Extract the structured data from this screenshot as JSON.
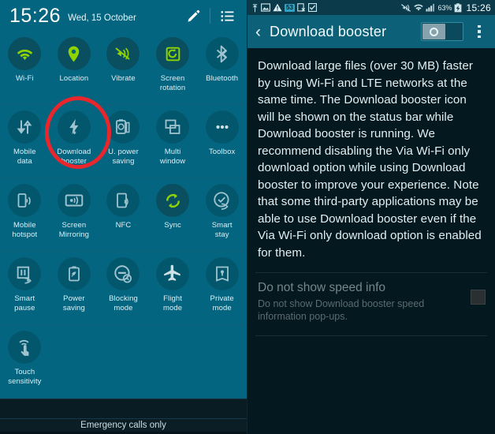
{
  "left_screen": {
    "header": {
      "clock": "15:26",
      "date": "Wed, 15 October",
      "edit_icon": "pencil-icon",
      "list_icon": "list-icon"
    },
    "quick_settings": [
      [
        {
          "label": "Wi-Fi",
          "icon": "wifi-icon",
          "state": "on"
        },
        {
          "label": "Location",
          "icon": "location-pin-icon",
          "state": "on"
        },
        {
          "label": "Vibrate",
          "icon": "vibrate-icon",
          "state": "on"
        },
        {
          "label": "Screen\nrotation",
          "icon": "screen-rotation-icon",
          "state": "on"
        },
        {
          "label": "Bluetooth",
          "icon": "bluetooth-icon",
          "state": "off"
        }
      ],
      [
        {
          "label": "Mobile\ndata",
          "icon": "mobile-data-icon",
          "state": "off"
        },
        {
          "label": "Download\nbooster",
          "icon": "download-booster-icon",
          "state": "off"
        },
        {
          "label": "U. power\nsaving",
          "icon": "ultra-power-saving-icon",
          "state": "off"
        },
        {
          "label": "Multi\nwindow",
          "icon": "multi-window-icon",
          "state": "off"
        },
        {
          "label": "Toolbox",
          "icon": "toolbox-icon",
          "state": "off"
        }
      ],
      [
        {
          "label": "Mobile\nhotspot",
          "icon": "mobile-hotspot-icon",
          "state": "off"
        },
        {
          "label": "Screen\nMirroring",
          "icon": "screen-mirroring-icon",
          "state": "off"
        },
        {
          "label": "NFC",
          "icon": "nfc-icon",
          "state": "off"
        },
        {
          "label": "Sync",
          "icon": "sync-icon",
          "state": "on"
        },
        {
          "label": "Smart\nstay",
          "icon": "smart-stay-icon",
          "state": "off"
        }
      ],
      [
        {
          "label": "Smart\npause",
          "icon": "smart-pause-icon",
          "state": "off"
        },
        {
          "label": "Power\nsaving",
          "icon": "power-saving-icon",
          "state": "off"
        },
        {
          "label": "Blocking\nmode",
          "icon": "blocking-mode-icon",
          "state": "off"
        },
        {
          "label": "Flight\nmode",
          "icon": "flight-mode-icon",
          "state": "off"
        },
        {
          "label": "Private\nmode",
          "icon": "private-mode-icon",
          "state": "off"
        }
      ],
      [
        {
          "label": "Touch\nsensitivity",
          "icon": "touch-sensitivity-icon",
          "state": "off"
        }
      ]
    ],
    "annotation": {
      "type": "red-ellipse-highlight",
      "target": "Download booster"
    },
    "status_text": "Emergency calls only"
  },
  "right_screen": {
    "status_bar": {
      "icons_left": [
        "usb-icon",
        "screenshot-icon",
        "warning-icon",
        "notification-count-badge",
        "no-sim-icon",
        "task-done-icon"
      ],
      "notification_count": "53",
      "icons_right": [
        "vibrate-mute-icon",
        "wifi-icon",
        "signal-bars-icon"
      ],
      "battery_percent": "63%",
      "battery_icon": "battery-charging-icon",
      "time": "15:26"
    },
    "app_bar": {
      "back_icon": "back-chevron-icon",
      "title": "Download booster",
      "toggle": {
        "name": "download-booster-toggle",
        "state": "on"
      },
      "overflow_icon": "kebab-menu-icon"
    },
    "description": "Download large files (over 30 MB) faster by using Wi-Fi and LTE networks at the same time. The Download booster icon will be shown on the status bar while Download booster is running. We recommend disabling the Via Wi-Fi only download option while using Download booster to improve your experience. Note that some third-party applications may be able to use Download booster even if the Via Wi-Fi only download option is enabled for them.",
    "preference": {
      "title": "Do not show speed info",
      "summary": "Do not show Download booster speed information pop-ups.",
      "checkbox_state": "unchecked"
    }
  },
  "colors": {
    "panel_teal": "#046580",
    "circle_teal": "#03576d",
    "accent_green": "#8fd400",
    "annotation_red": "#e8262c",
    "dark_navy": "#03181f",
    "appbar_teal": "#0c6077",
    "statusbar_teal": "#0b3b4a"
  }
}
